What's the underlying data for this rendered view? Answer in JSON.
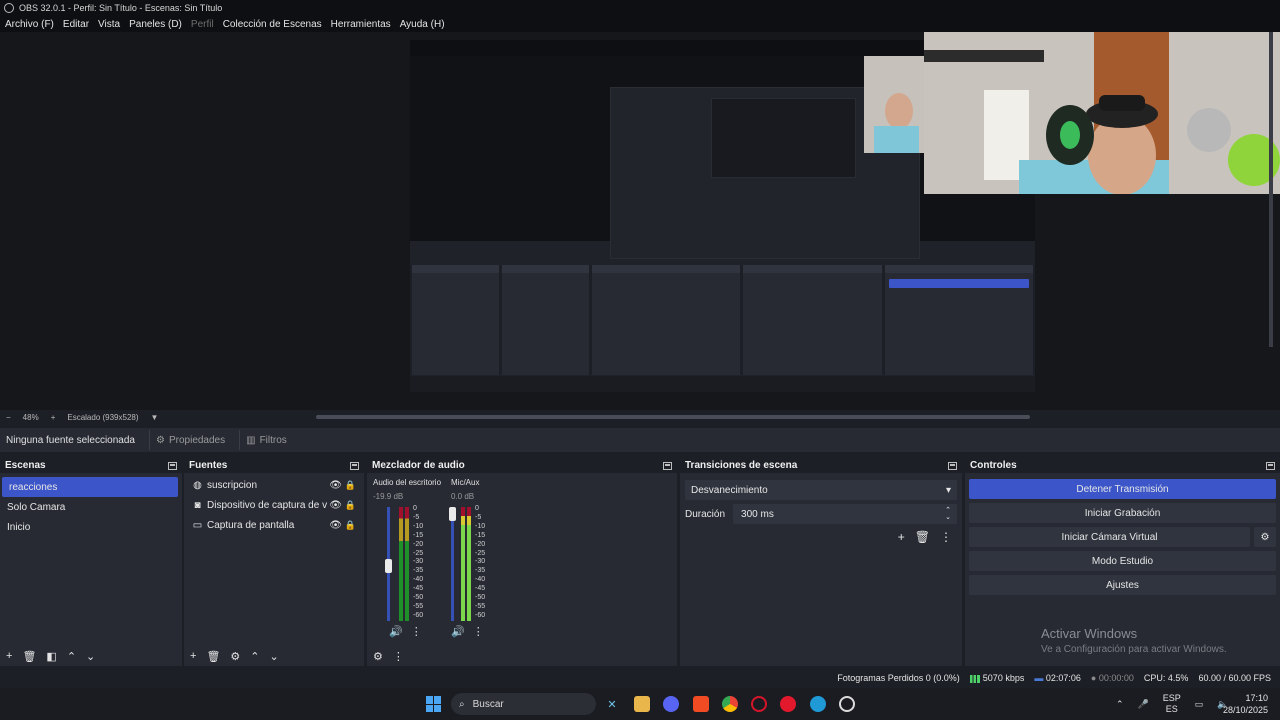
{
  "window": {
    "title": "OBS 32.0.1 - Perfil: Sin Título - Escenas: Sin Título"
  },
  "menu": [
    "Archivo (F)",
    "Editar",
    "Vista",
    "Paneles (D)",
    "Perfil",
    "Colección de Escenas",
    "Herramientas",
    "Ayuda (H)"
  ],
  "preview_bar": {
    "zoom": "48%",
    "scale_label": "Escalado (939x528)"
  },
  "context": {
    "no_source": "Ninguna fuente seleccionada",
    "properties": "Propiedades",
    "filters": "Filtros"
  },
  "scenes": {
    "title": "Escenas",
    "items": [
      "reacciones",
      "Solo Camara",
      "Inicio"
    ],
    "selected": 0
  },
  "sources": {
    "title": "Fuentes",
    "items": [
      {
        "name": "suscripcion",
        "icon": "globe-icon"
      },
      {
        "name": "Dispositivo de captura de video",
        "icon": "camera-icon"
      },
      {
        "name": "Captura de pantalla",
        "icon": "monitor-icon"
      }
    ]
  },
  "mixer": {
    "title": "Mezclador de audio",
    "channels": [
      {
        "name": "Audio del escritorio",
        "db": "-19.9 dB"
      },
      {
        "name": "Mic/Aux",
        "db": "0.0 dB"
      }
    ],
    "scale": [
      "0",
      "-5",
      "-10",
      "-15",
      "-20",
      "-25",
      "-30",
      "-35",
      "-40",
      "-45",
      "-50",
      "-55",
      "-60"
    ]
  },
  "transitions": {
    "title": "Transiciones de escena",
    "selected": "Desvanecimiento",
    "duration_label": "Duración",
    "duration": "300 ms"
  },
  "controls": {
    "title": "Controles",
    "stop_stream": "Detener Transmisión",
    "start_recording": "Iniciar Grabación",
    "virtual_cam": "Iniciar Cámara Virtual",
    "studio_mode": "Modo Estudio",
    "settings": "Ajustes"
  },
  "watermark": {
    "title": "Activar Windows",
    "subtitle": "Ve a Configuración para activar Windows."
  },
  "status": {
    "dropped_frames": "Fotogramas Perdidos 0 (0.0%)",
    "bitrate": "5070 kbps",
    "stream_time": "02:07:06",
    "rec_time": "00:00:00",
    "cpu": "CPU: 4.5%",
    "fps": "60.00 / 60.00 FPS"
  },
  "taskbar": {
    "search_placeholder": "Buscar",
    "lang_top": "ESP",
    "lang_bottom": "ES",
    "time": "17:10",
    "date": "28/10/2025"
  },
  "colors": {
    "accent": "#3c56c9",
    "panel": "#272a33",
    "background": "#1d1f26"
  }
}
